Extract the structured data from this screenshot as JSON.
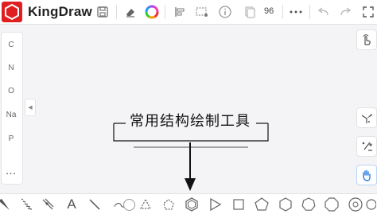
{
  "app": {
    "title": "KingDraw"
  },
  "toolbar": {
    "zoom_level": "96"
  },
  "elements_panel": {
    "items": [
      "C",
      "N",
      "O",
      "Na",
      "P"
    ],
    "more": "…"
  },
  "canvas": {
    "callout_text": "常用结构绘制工具"
  },
  "bottom_tools": {
    "text_tool_label": "A"
  },
  "icons": {
    "logo": "kingdraw-logo-icon",
    "save": "save-icon",
    "eraser": "eraser-icon",
    "color": "color-wheel-icon",
    "align": "align-icon",
    "select": "lasso-select-icon",
    "info": "info-icon",
    "copy": "copy-icon",
    "more": "more-icon",
    "undo": "undo-icon",
    "redo": "redo-icon",
    "fullscreen": "fullscreen-icon"
  },
  "colors": {
    "brand": "#e02020",
    "accent_blue": "#2a7be4"
  }
}
